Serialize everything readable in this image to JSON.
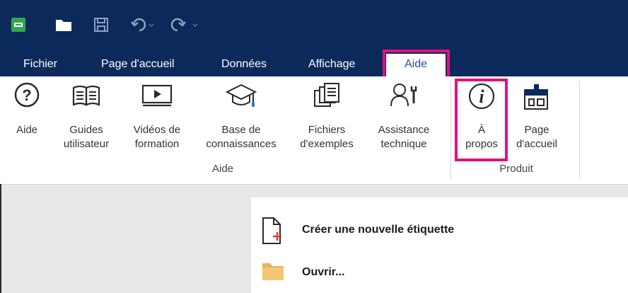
{
  "titlebar": {
    "bg": "#0b2a5b"
  },
  "quick_access": {
    "app_icon": "app-icon",
    "open_icon": "folder-open-icon",
    "save_icon": "save-icon",
    "undo_icon": "undo-icon",
    "redo_icon": "redo-icon"
  },
  "tabs": [
    {
      "label": "Fichier"
    },
    {
      "label": "Page d'accueil"
    },
    {
      "label": "Données"
    },
    {
      "label": "Affichage"
    },
    {
      "label": "Aide"
    }
  ],
  "ribbon": {
    "groups": [
      {
        "label": "Aide",
        "buttons": [
          {
            "label": "Aide",
            "icon": "help-circle-icon"
          },
          {
            "label": "Guides\nutilisateur",
            "icon": "book-icon"
          },
          {
            "label": "Vidéos de\nformation",
            "icon": "video-icon"
          },
          {
            "label": "Base de\nconnaissances",
            "icon": "graduation-cap-icon"
          },
          {
            "label": "Fichiers\nd'exemples",
            "icon": "sample-files-icon"
          },
          {
            "label": "Assistance\ntechnique",
            "icon": "tech-support-icon"
          }
        ]
      },
      {
        "label": "Produit",
        "buttons": [
          {
            "label": "À\npropos",
            "icon": "info-icon"
          },
          {
            "label": "Page\nd'accueil",
            "icon": "home-page-icon"
          }
        ]
      }
    ]
  },
  "panel": {
    "items": [
      {
        "label": "Créer une nouvelle étiquette",
        "icon": "new-label-icon"
      },
      {
        "label": "Ouvrir...",
        "icon": "folder-icon"
      }
    ]
  },
  "colors": {
    "accent": "#e0127b",
    "brand": "#0b2a5b",
    "active_tab_text": "#1f4f9e"
  }
}
